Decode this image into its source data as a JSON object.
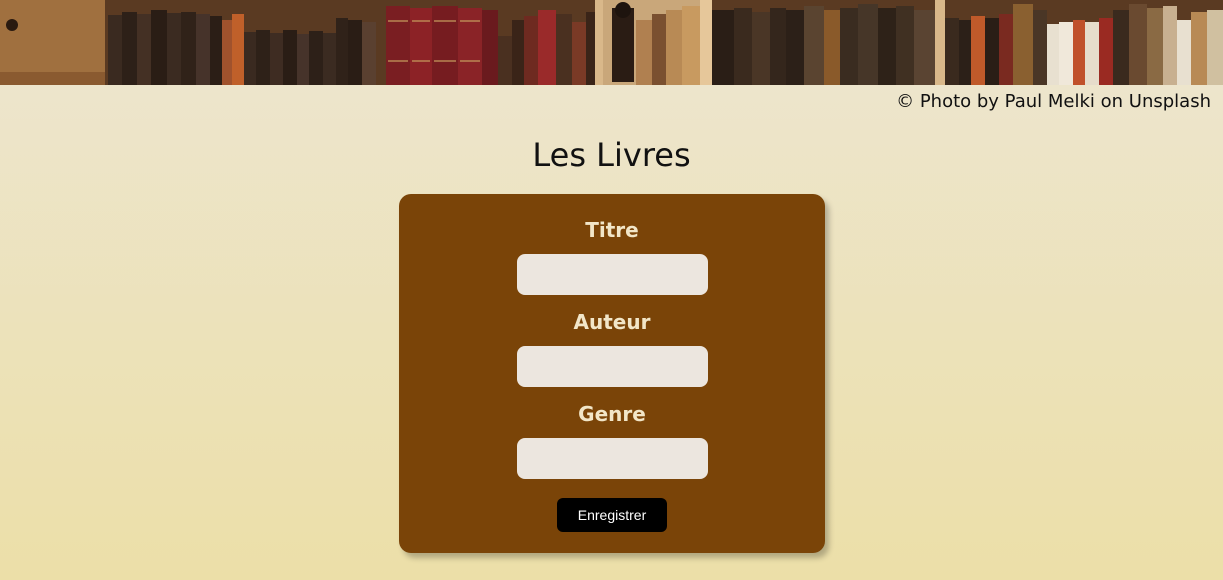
{
  "banner": {
    "alt": "bookshelf-banner"
  },
  "credit": "© Photo by Paul Melki on Unsplash",
  "page_title": "Les Livres",
  "form": {
    "fields": [
      {
        "label": "Titre",
        "value": "",
        "placeholder": ""
      },
      {
        "label": "Auteur",
        "value": "",
        "placeholder": ""
      },
      {
        "label": "Genre",
        "value": "",
        "placeholder": ""
      }
    ],
    "submit_label": "Enregistrer"
  },
  "colors": {
    "card": "#7a4408",
    "label": "#f2e6c8",
    "input": "#ece6df",
    "button": "#000000"
  }
}
